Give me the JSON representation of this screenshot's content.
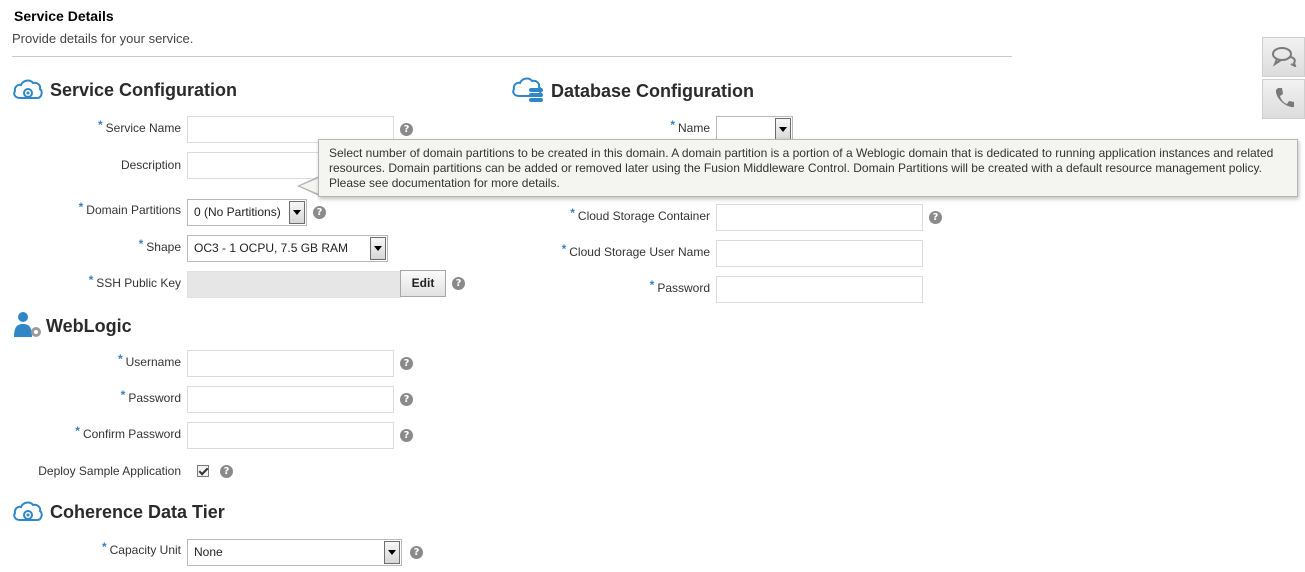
{
  "header": {
    "title": "Service Details",
    "subtitle": "Provide details for your service."
  },
  "service_config": {
    "title": "Service Configuration",
    "service_name": {
      "label": "Service Name",
      "value": "",
      "required": true
    },
    "description": {
      "label": "Description",
      "value": ""
    },
    "domain_partitions": {
      "label": "Domain Partitions",
      "value": "0 (No Partitions)",
      "required": true
    },
    "shape": {
      "label": "Shape",
      "value": "OC3 - 1 OCPU, 7.5 GB RAM",
      "required": true
    },
    "ssh_key": {
      "label": "SSH Public Key",
      "value": "",
      "edit_label": "Edit",
      "required": true
    }
  },
  "weblogic": {
    "title": "WebLogic",
    "username": {
      "label": "Username",
      "value": "",
      "required": true
    },
    "password": {
      "label": "Password",
      "value": "",
      "required": true
    },
    "confirm_password": {
      "label": "Confirm Password",
      "value": "",
      "required": true
    },
    "deploy_sample": {
      "label": "Deploy Sample Application",
      "checked": true
    }
  },
  "coherence": {
    "title": "Coherence Data Tier",
    "capacity_unit": {
      "label": "Capacity Unit",
      "value": "None",
      "required": true
    }
  },
  "database_config": {
    "title": "Database Configuration",
    "name": {
      "label": "Name",
      "value": "",
      "required": true
    },
    "storage_container": {
      "label": "Cloud Storage Container",
      "value": "",
      "required": true
    },
    "storage_user": {
      "label": "Cloud Storage User Name",
      "value": "",
      "required": true
    },
    "password": {
      "label": "Password",
      "value": "",
      "required": true
    }
  },
  "tooltip": {
    "text": "Select number of domain partitions to be created in this domain. A domain partition is a portion of a Weblogic domain that is dedicated to running application instances and related resources. Domain partitions can be added or removed later using the Fusion Middleware Control. Domain Partitions will be created with a default resource management policy. Please see documentation for more details."
  },
  "required_marker": "*",
  "help_glyph": "?",
  "icons": {
    "cloud": "cloud-gear-icon",
    "database": "cloud-database-icon",
    "user": "user-key-icon",
    "chat": "chat-icon",
    "phone": "phone-icon"
  },
  "colors": {
    "required": "#3b7fc4",
    "icon_blue": "#2f87c8",
    "tooltip_bg": "#f4f4f0"
  }
}
